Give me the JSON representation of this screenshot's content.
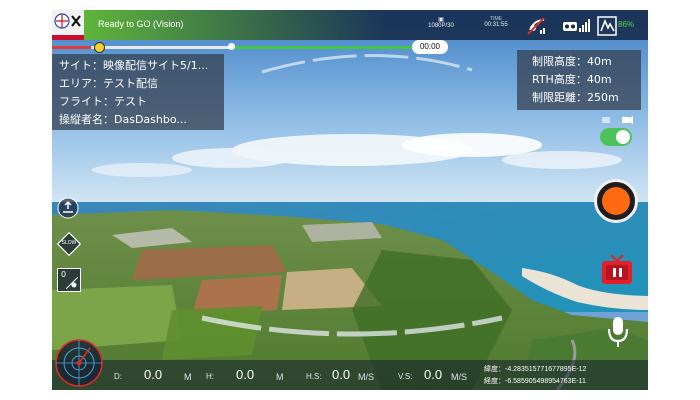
{
  "status": {
    "message": "Ready to GO (Vision)",
    "video_mode": "1080P/30",
    "time_label": "TIME",
    "time_value": "00:31:55",
    "battery_percent": "86%"
  },
  "playback": {
    "elapsed": "00:00",
    "progress_fraction": 0.1
  },
  "flight_info": {
    "site": "サイト：映像配信サイト5/1...",
    "area": "エリア：テスト配信",
    "flight": "フライト：テスト",
    "operator": "操縦者名：DasDashbo..."
  },
  "limits": {
    "max_altitude": "制限高度：40m",
    "rth_altitude": "RTH高度：40m",
    "max_distance": "制限距離：250m"
  },
  "controls": {
    "slow_label": "SLOW",
    "ae_number": "0"
  },
  "telemetry": {
    "d_label": "D:",
    "d_value": "0.0",
    "d_unit": "M",
    "h_label": "H:",
    "h_value": "0.0",
    "h_unit": "M",
    "hs_label": "H.S:",
    "hs_value": "0.0",
    "hs_unit": "M/S",
    "vs_label": "V.S:",
    "vs_value": "0.0",
    "vs_unit": "M/S"
  },
  "gps": {
    "latitude": "緯度：-4.283515771677895E-12",
    "longitude": "経度：-6.585905498954763E-11"
  },
  "colors": {
    "status_green": "#5fb53b",
    "record_orange": "#ff6a13",
    "toggle_green": "#4cc35a",
    "progress_red": "#e23b3b",
    "live_red": "#e0202a"
  }
}
